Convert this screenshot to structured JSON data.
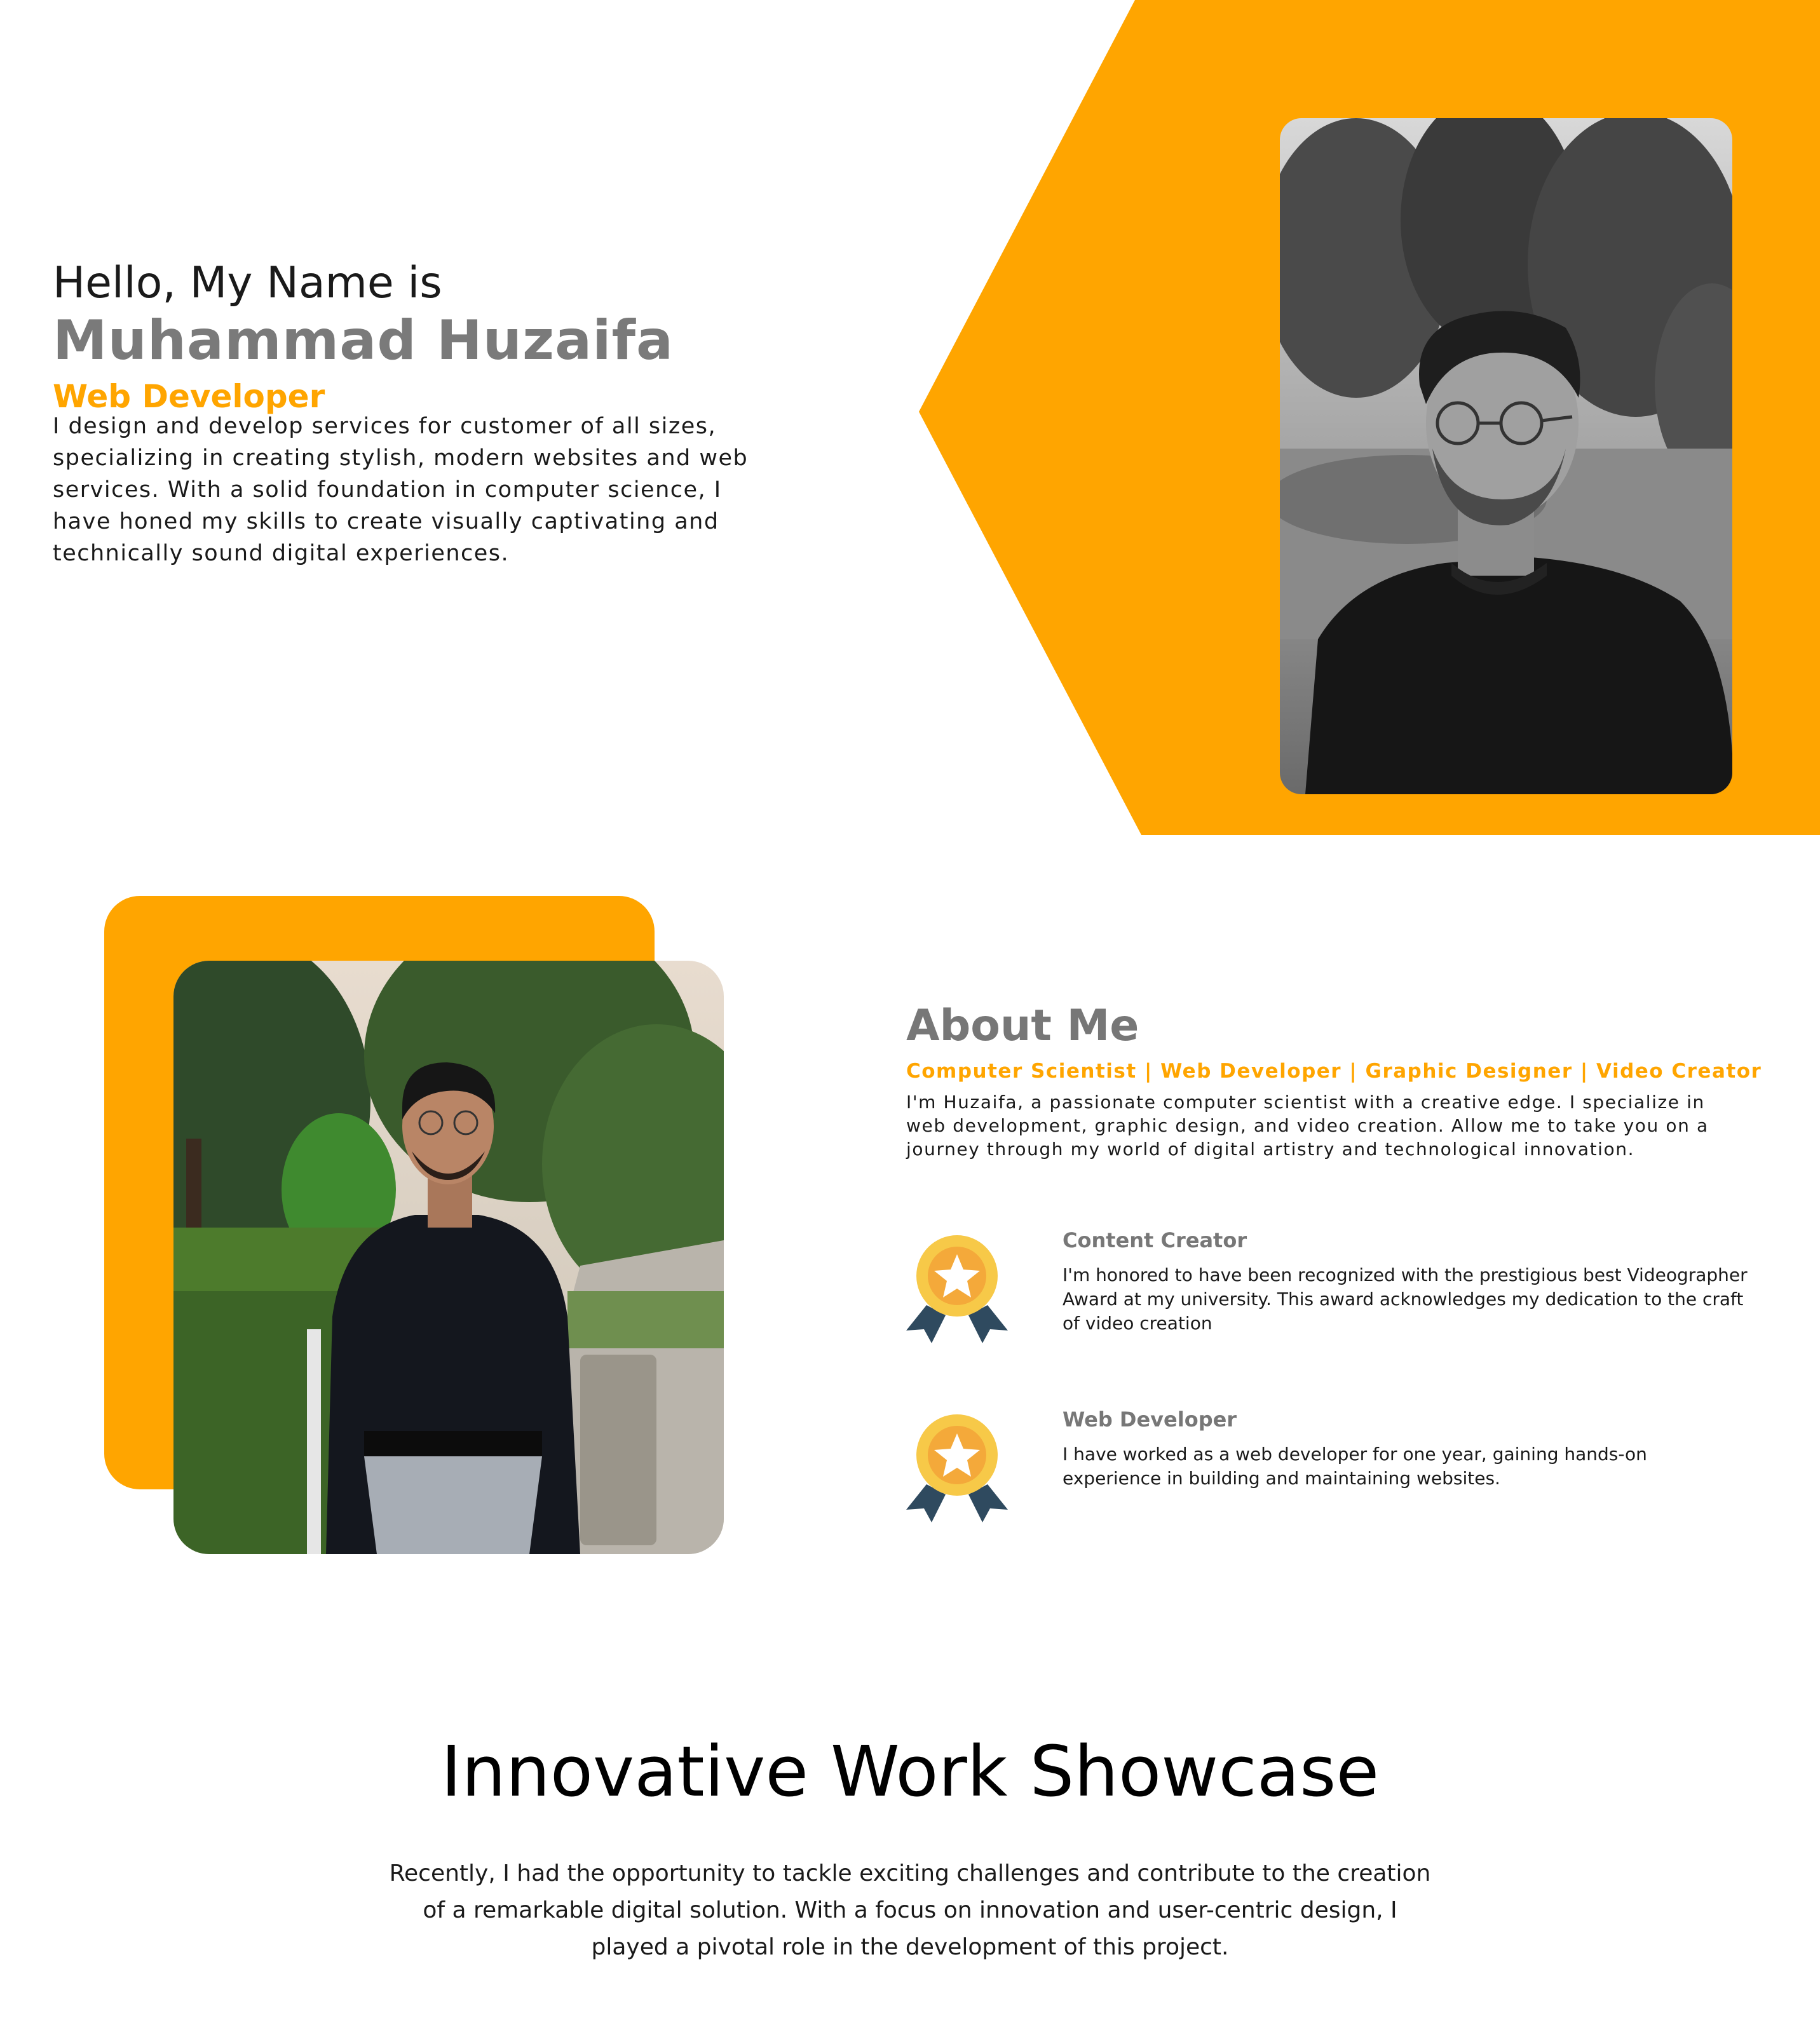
{
  "colors": {
    "accent": "#FFA500",
    "heading_gray": "#777777",
    "text": "#1a1a1a"
  },
  "hero": {
    "greeting": "Hello, My Name is",
    "name": "Muhammad Huzaifa",
    "role": "Web Developer",
    "description": "I design and develop services for customer of all sizes, specializing in creating stylish, modern websites and web services. With a solid foundation in computer science, I have honed my skills to create visually captivating and technically sound digital experiences.",
    "photo": "profile-portrait-bw"
  },
  "about": {
    "title": "About Me",
    "subtitle": "Computer Scientist | Web Developer | Graphic Designer | Video Creator",
    "description": "I'm Huzaifa, a passionate computer scientist with a creative edge. I specialize in web development, graphic design, and video creation. Allow me to take you on a journey through my world of digital artistry and technological innovation.",
    "photo": "profile-full-body-color",
    "awards": [
      {
        "icon": "award-medal-icon",
        "title": "Content Creator",
        "text": "I'm honored to have been recognized with the prestigious best Videographer Award at my university. This award acknowledges my dedication to the craft of video creation"
      },
      {
        "icon": "award-medal-icon",
        "title": "Web Developer",
        "text": "I have worked as a web developer for one year, gaining hands-on experience in building and maintaining websites."
      }
    ]
  },
  "showcase": {
    "title": "Innovative Work Showcase",
    "description": "Recently, I had the opportunity to tackle exciting challenges and contribute to the creation of a remarkable digital solution. With a focus on innovation and user-centric design, I played a pivotal role in the development of this project."
  }
}
